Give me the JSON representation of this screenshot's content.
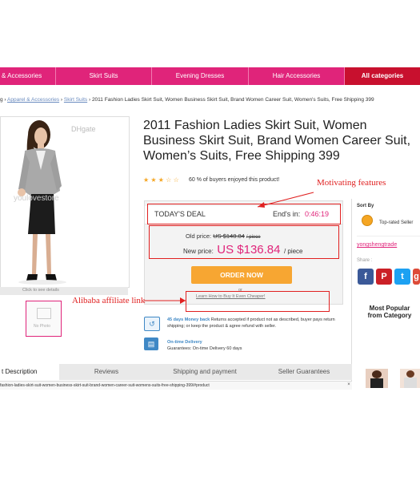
{
  "nav": {
    "items": [
      "& Accessories",
      "Skirt Suits",
      "Evening Dresses",
      "Hair Accessories",
      "All categories"
    ]
  },
  "breadcrumb": {
    "sep1": "g ›",
    "link1": "Apparel & Accessories",
    "sep2": "›",
    "link2": "Skirt Suits",
    "current": "› 2011 Fashion Ladies Skirt Suit, Women Business Skirt Suit, Brand Women Career Suit, Women's Suits, Free Shipping 399"
  },
  "product": {
    "watermark": "youlovestore",
    "click_to_see": "Click to see details",
    "no_photo": "No Photo",
    "title": "2011 Fashion Ladies Skirt Suit, Women Business Skirt Suit, Brand Women Career Suit, Women’s Suits, Free Shipping 399",
    "rating_stars": "★ ★ ★ ☆ ☆",
    "rating_text": "60 % of buyers enjoyed this product!",
    "rating_value": 3
  },
  "deal": {
    "label": "TODAY'S DEAL",
    "ends_label": "End's in:",
    "ends_time": "0:46:19",
    "old_price_label": "Old price:",
    "old_price": "US $148.84",
    "old_price_unit": "/ piece",
    "new_price_label": "New price:",
    "new_price": "US $136.84",
    "new_price_unit": "/ piece",
    "order_button": "ORDER NOW",
    "or_text": "or",
    "cheaper_link": "Learn How to Buy It Even Cheaper!"
  },
  "guarantees": {
    "money_back_title": "45 days Money back",
    "money_back_text": "Returns accepted if product not as described, buyer pays return shipping; or keep the product & agree refund with seller.",
    "delivery_title": "On-time Delivery",
    "delivery_text": "Guarantees: On-time Delivery 60 days"
  },
  "annotations": {
    "motivating": "Motivating features",
    "affiliate": "Alibaba affiliate link"
  },
  "sidebar": {
    "sort_by": "Sort By",
    "top_rated": "Top-rated Seller",
    "seller": "yongshengtrade",
    "share": "Share :",
    "most_popular": "Most Popular from Category"
  },
  "tabs": {
    "items": [
      "t Description",
      "Reviews",
      "Shipping and payment",
      "Seller Guarantees"
    ]
  },
  "status_url": "fashion-ladies-skirt-suit-women-business-skirt-suit-brand-women-career-suit-womens-suits-free-shipping-399/#product",
  "colors": {
    "nav_pink": "#e0247a",
    "nav_red": "#c8102e",
    "price_pink": "#e0247a",
    "order_orange": "#f7a632",
    "annotation_red": "#e02020"
  }
}
